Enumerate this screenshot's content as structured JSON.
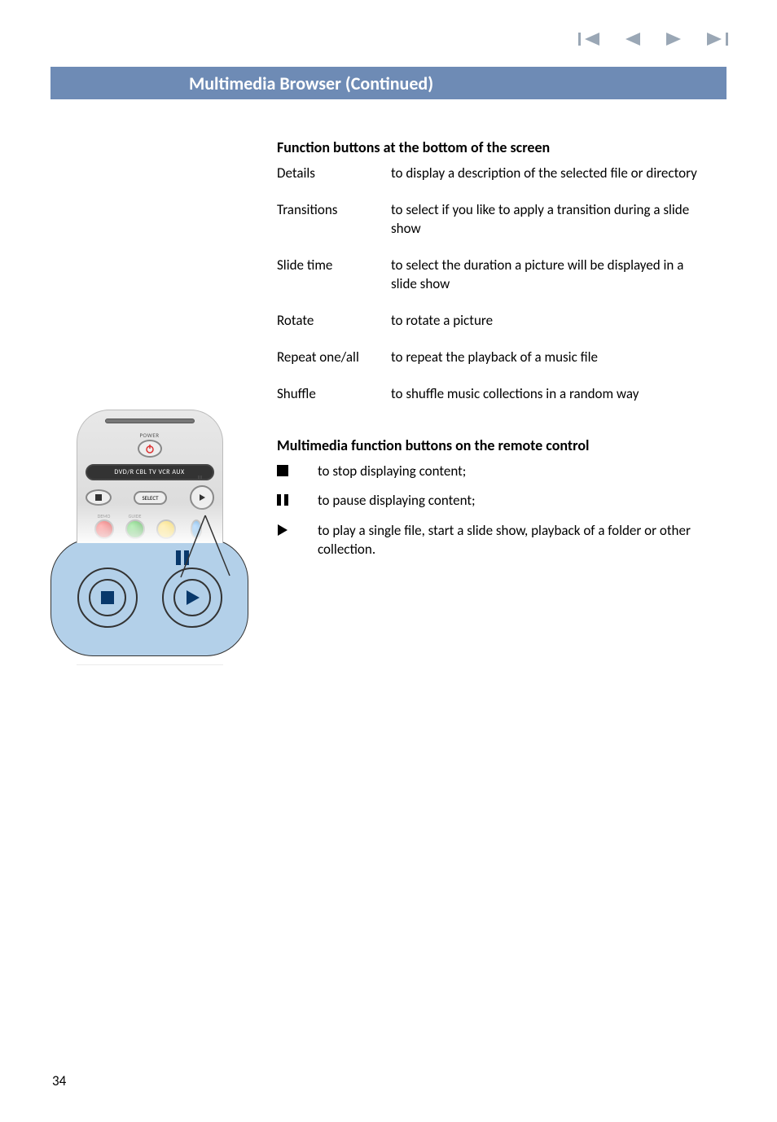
{
  "nav": {
    "first": "first-page",
    "prev": "prev-page",
    "next": "next-page",
    "last": "last-page"
  },
  "title": "Multimedia Browser  (Continued)",
  "function_buttons": {
    "heading": "Function buttons at the bottom of the screen",
    "rows": [
      {
        "label": "Details",
        "desc": "to display a description of the selected file or directory"
      },
      {
        "label": "Transitions",
        "desc": "to select if you like to apply a transition during a slide show"
      },
      {
        "label": "Slide time",
        "desc": "to select the duration a picture will be displayed in a slide show"
      },
      {
        "label": "Rotate",
        "desc": "to rotate a picture"
      },
      {
        "label": "Repeat one/all",
        "desc": "to repeat the playback of a music file"
      },
      {
        "label": "Shuffle",
        "desc": "to shuffle music collections in a random way"
      }
    ]
  },
  "multimedia_functions": {
    "heading": "Multimedia function buttons on the remote control",
    "rows": [
      {
        "icon": "stop",
        "desc": "to stop displaying content;"
      },
      {
        "icon": "pause",
        "desc": "to pause displaying content;"
      },
      {
        "icon": "play",
        "desc": "to play a single file, start a slide show, playback of a folder or other collection."
      }
    ]
  },
  "remote": {
    "power_label": "POWER",
    "mode_row": "DVD/R  CBL  TV  VCR  AUX",
    "select_label": "SELECT",
    "label_demo": "DEMO",
    "label_guide": "GUIDE"
  },
  "page_number": "34"
}
